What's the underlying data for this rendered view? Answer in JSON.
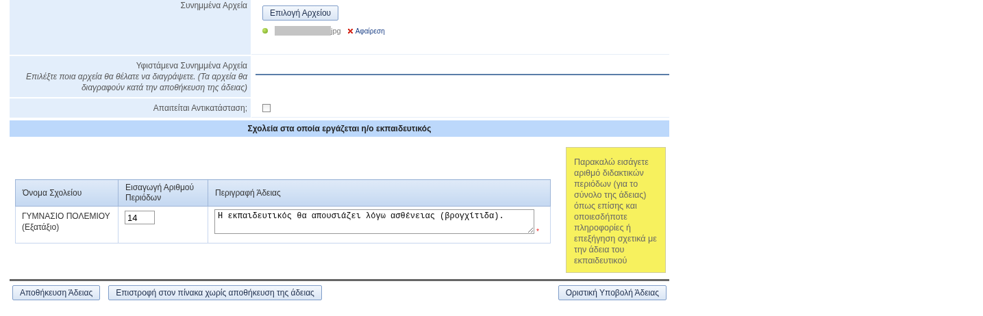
{
  "attachments": {
    "label": "Συνημμένα Αρχεία",
    "choose_button": "Επιλογή Αρχείου",
    "files": [
      {
        "name": "jpg",
        "remove": "Αφαίρεση"
      }
    ]
  },
  "existing": {
    "label": "Υφιστάμενα Συνημμένα Αρχεία",
    "hint": "Επιλέξτε ποια αρχεία θα θέλατε να διαγράψετε. (Τα αρχεία θα διαγραφούν κατά την αποθήκευση της άδειας)"
  },
  "replacement": {
    "label": "Απαιτείται Αντικατάσταση;",
    "checked": false
  },
  "schools_header": "Σχολεία στα οποία εργάζεται η/ο εκπαιδευτικός",
  "table": {
    "columns": [
      "Όνομα Σχολείου",
      "Εισαγωγή Αριθμού Περιόδων",
      "Περιγραφή Άδειας"
    ],
    "rows": [
      {
        "school": "ΓΥΜΝΑΣΙΟ ΠΟΛΕΜΙΟΥ (Εξατάξιο)",
        "periods": "14",
        "description": "Η εκπαιδευτικός θα απουσιάζει λόγω ασθένειας (βρογχίτιδα).",
        "required_mark": "*"
      }
    ]
  },
  "note": "Παρακαλώ εισάγετε αριθμό διδακτικών περιόδων (για το σύνολο της άδειας) όπως επίσης και οποιεσδήποτε πληροφορίες ή επεξήγηση σχετικά με την άδεια του εκπαιδευτικού",
  "buttons": [
    {
      "label": "Αποθήκευση Άδειας",
      "kind": "action"
    },
    {
      "label": "Επιστροφή στον πίνακα χωρίς αποθήκευση της άδειας",
      "kind": "action"
    },
    {
      "label": "Οριστική Υποβολή Άδειας",
      "kind": "submit"
    }
  ]
}
